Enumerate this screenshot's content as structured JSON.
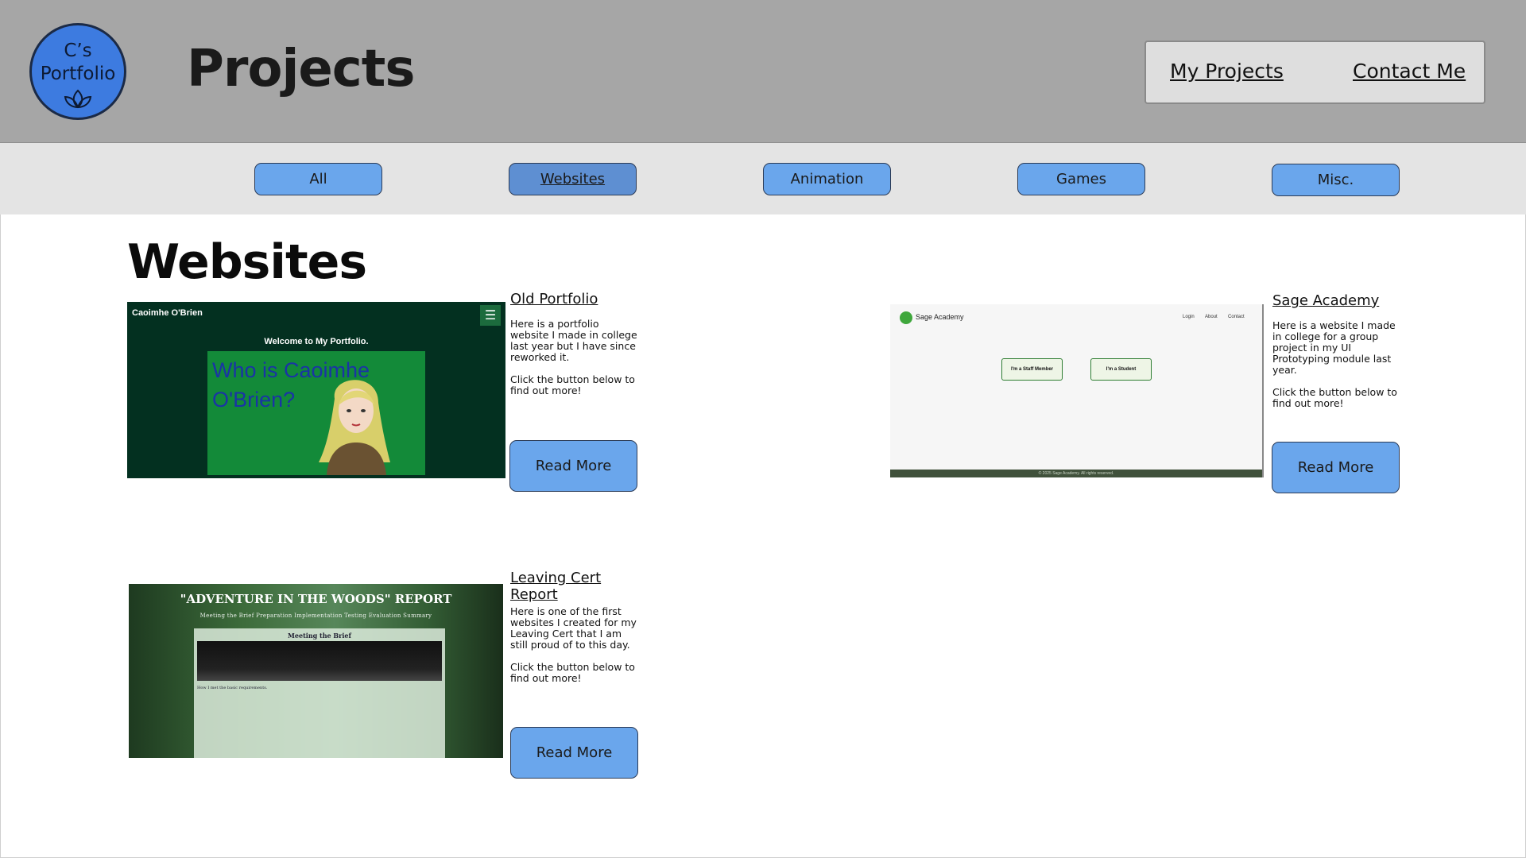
{
  "header": {
    "logo_text": "C’s\nPortfolio",
    "title": "Projects",
    "nav": {
      "my_projects": "My Projects",
      "contact_me": "Contact Me"
    }
  },
  "filters": {
    "all": "All",
    "websites": "Websites",
    "animation": "Animation",
    "games": "Games",
    "misc": "Misc.",
    "active": "Websites"
  },
  "section": {
    "title": "Websites"
  },
  "cards": [
    {
      "title": "Old Portfolio",
      "desc1": "Here is a portfolio website I made in college last year but I have since reworked it.",
      "desc2": "Click the button below to find out more!",
      "button": "Read More",
      "preview": {
        "name": "Caoimhe O'Brien",
        "welcome": "Welcome to My Portfolio.",
        "heading": "Who is Caoimhe O'Brien?"
      }
    },
    {
      "title": "Sage Academy",
      "desc1": "Here is a website I made in college for a group project in my UI Prototyping module last year.",
      "desc2": "Click the button below to find out more!",
      "button": "Read More",
      "preview": {
        "brand": "Sage Academy",
        "nav_login": "Login",
        "nav_about": "About",
        "nav_contact": "Contact",
        "btn_staff": "I'm a Staff Member",
        "btn_student": "I'm a Student",
        "footer": "© 2025 Sage Academy. All rights reserved."
      }
    },
    {
      "title": "Leaving Cert Report",
      "desc1": "Here is one of the first websites I created for my Leaving Cert that I am still proud of to this day.",
      "desc2": "Click the button below to find out more!",
      "button": "Read More",
      "preview": {
        "title": "\"ADVENTURE IN THE WOODS\" REPORT",
        "nav": "Meeting the Brief   Preparation   Implementation   Testing   Evaluation   Summary",
        "panel_title": "Meeting the Brief",
        "panel_text": "How I met the basic requirements."
      }
    }
  ],
  "colors": {
    "header_bg": "#a6a6a6",
    "filter_bg": "#e4e4e4",
    "button_bg": "#6aa6ec",
    "logo_bg": "#3d7be0"
  }
}
